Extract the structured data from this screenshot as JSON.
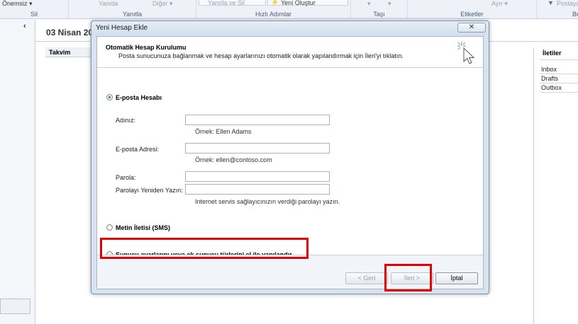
{
  "ribbon": {
    "onemsiz": "Önemsiz ▾",
    "sil": "Sil",
    "yanitla_item": "Yanıtla",
    "diger": "Diğer ▾",
    "yanitla_group": "Yanıtla",
    "yanitla_ve_sil": "Yanıtla ve Sil",
    "yeni_olustur": "Yeni Oluştur",
    "hizli_adimlar": "Hızlı Adımlar",
    "tasi": "Taşı",
    "etiketler": "Etiketler",
    "ayir": "Ayır ▾",
    "postayi": "Postayı",
    "bul": "Bu"
  },
  "main": {
    "date_title": "03 Nisan 20",
    "takvim": "Takvim",
    "collapse_glyph": "‹"
  },
  "folders": {
    "header": "İletiler",
    "items": [
      "Inbox",
      "Drafts",
      "Outbox"
    ]
  },
  "dialog": {
    "title": "Yeni Hesap Ekle",
    "close_glyph": "✕",
    "header_title": "Otomatik Hesap Kurulumu",
    "header_desc": "Posta sunucunuza bağlanmak ve hesap ayarlarınızı otomatik olarak yapılandırmak için İleri'yi tıklatın.",
    "email_option": "E-posta Hesabı",
    "name_label": "Adınız:",
    "name_value": "",
    "name_hint": "Örnek: Ellen Adams",
    "email_label": "E-posta Adresi:",
    "email_value": "",
    "email_hint": "Örnek: ellen@contoso.com",
    "password_label": "Parola:",
    "password_value": "",
    "retype_label": "Parolayı Yeniden Yazın:",
    "retype_value": "",
    "password_hint": "Internet servis sağlayıcınızın verdiği parolayı yazın.",
    "sms_option": "Metin İletisi (SMS)",
    "manual_option": "Sunucu ayarlarını veya ek sunucu türlerini el ile yapılandır",
    "back_button": "< Geri",
    "next_button": "İleri >",
    "cancel_button": "İptal"
  },
  "colors": {
    "highlight": "#e30000",
    "dialog_frame": "#d9e3ef",
    "ribbon_bg": "#eef2f8"
  },
  "icons": {
    "wizard": "magic-wand-cursor-icon",
    "close": "close-icon"
  }
}
